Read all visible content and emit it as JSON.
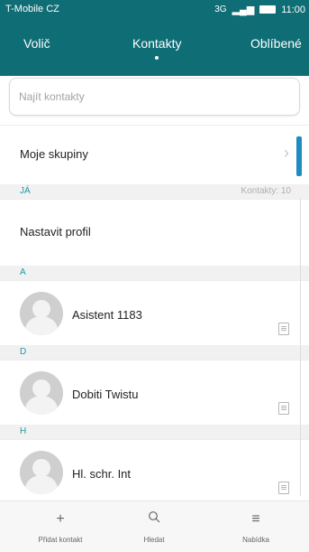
{
  "status_bar": {
    "carrier": "T-Mobile CZ",
    "network": "3G",
    "time": "11:00"
  },
  "tabs": [
    {
      "label": "Volič"
    },
    {
      "label": "Kontakty"
    },
    {
      "label": "Oblíbené"
    }
  ],
  "search": {
    "placeholder": "Najít kontakty"
  },
  "groups_row": {
    "label": "Moje skupiny"
  },
  "sections": {
    "ja": {
      "label": "JÁ",
      "count_text": "Kontakty: 10"
    },
    "a": {
      "label": "A"
    },
    "d": {
      "label": "D"
    },
    "h": {
      "label": "H"
    }
  },
  "profile_row": {
    "label": "Nastavit profil"
  },
  "contacts": [
    {
      "name": "Asistent 1183"
    },
    {
      "name": "Dobiti Twistu"
    },
    {
      "name": "Hl. schr. Int"
    }
  ],
  "bottom_bar": [
    {
      "label": "Přidat kontakt",
      "icon": "plus-icon"
    },
    {
      "label": "Hledat",
      "icon": "search-icon"
    },
    {
      "label": "Nabídka",
      "icon": "menu-icon"
    }
  ],
  "colors": {
    "header": "#0f6e75",
    "accent": "#1f9aa5",
    "scroll_indicator": "#1e8bc3"
  }
}
